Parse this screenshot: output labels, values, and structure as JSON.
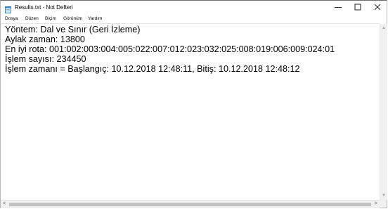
{
  "window": {
    "title": "Results.txt - Not Defteri"
  },
  "menu": {
    "items": [
      "Dosya",
      "Düzen",
      "Biçim",
      "Görünüm",
      "Yardım"
    ]
  },
  "document": {
    "lines": [
      "Yöntem: Dal ve Sınır (Geri İzleme)",
      "Aylak zaman: 13800",
      "En iyi rota: 001:002:003:004:005:022:007:012:023:032:025:008:019:006:009:024:01",
      "İşlem sayısı: 234450",
      "İşlem zamanı = Başlangıç: 10.12.2018 12:48:11, Bitiş: 10.12.2018 12:48:12"
    ]
  },
  "icons": {
    "app": "notepad-icon",
    "minimize": "minimize-icon",
    "maximize": "maximize-icon",
    "close": "close-icon"
  }
}
